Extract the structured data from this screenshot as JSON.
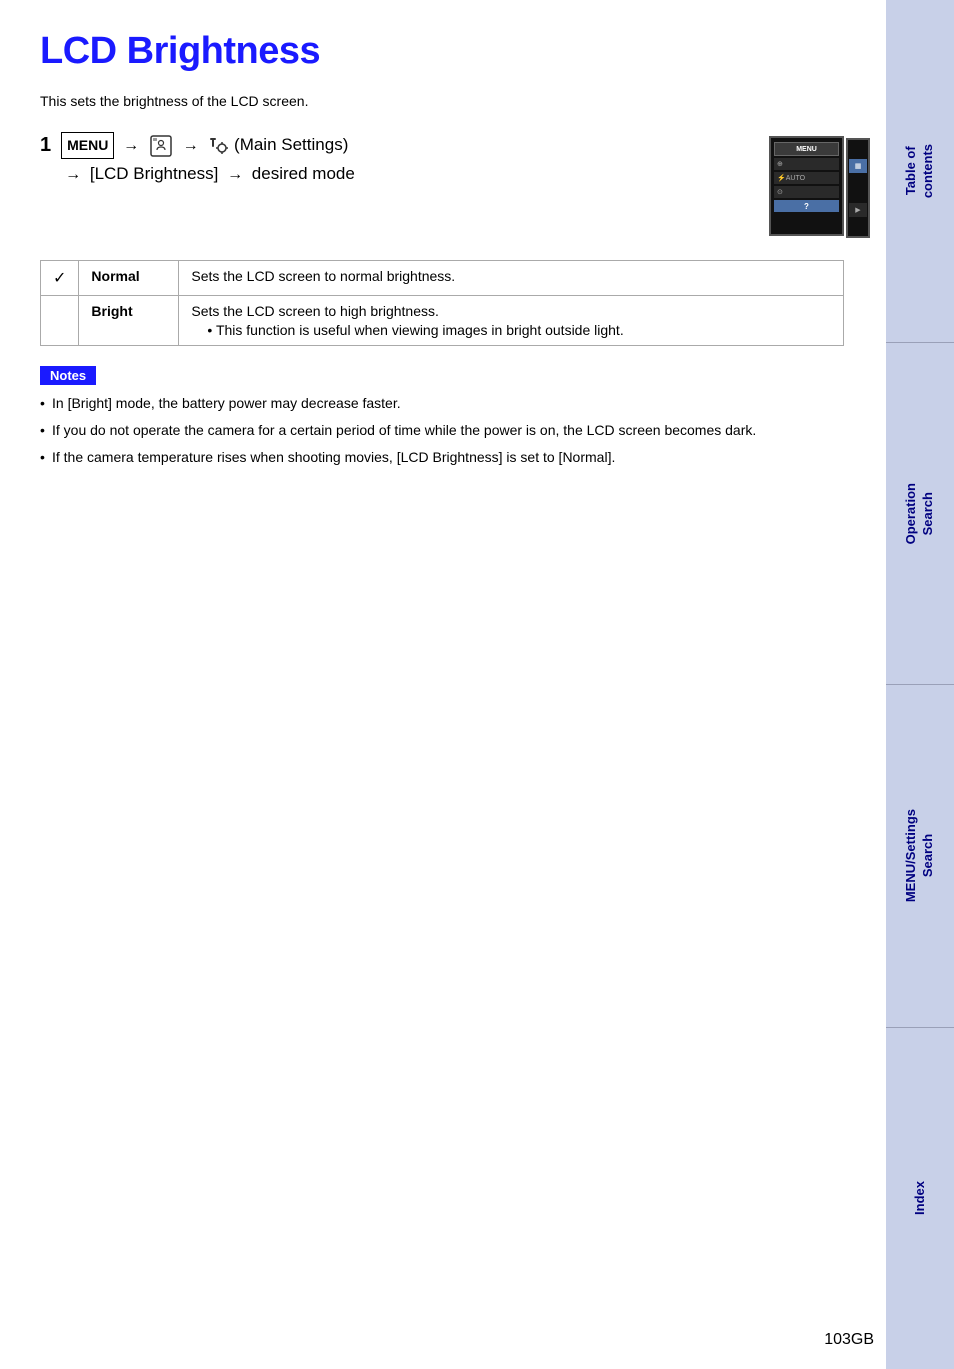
{
  "page": {
    "title": "LCD Brightness",
    "intro": "This sets the brightness of the LCD screen.",
    "step1": {
      "number": "1",
      "instruction_line1": " (Settings)  (Main Settings)",
      "instruction_line2": " [LCD Brightness]  desired mode"
    },
    "table": {
      "rows": [
        {
          "checkmark": "✓",
          "mode": "Normal",
          "description": "Sets the LCD screen to normal brightness.",
          "sub_bullets": []
        },
        {
          "checkmark": "",
          "mode": "Bright",
          "description": "Sets the LCD screen to high brightness.",
          "sub_bullets": [
            "This function is useful when viewing images in bright outside light."
          ]
        }
      ]
    },
    "notes": {
      "badge": "Notes",
      "items": [
        "In [Bright] mode, the battery power may decrease faster.",
        "If you do not operate the camera for a certain period of time while the power is on, the LCD screen becomes dark.",
        "If the camera temperature rises when shooting movies, [LCD Brightness] is set to [Normal]."
      ]
    },
    "page_number": "103GB"
  },
  "sidebar": {
    "sections": [
      {
        "id": "table-of-contents",
        "label_line1": "Table of",
        "label_line2": "contents"
      },
      {
        "id": "operation-search",
        "label_line1": "Operation",
        "label_line2": "Search"
      },
      {
        "id": "menu-settings-search",
        "label_line1": "MENU/Settings",
        "label_line2": "Search"
      },
      {
        "id": "index",
        "label_line1": "Index",
        "label_line2": ""
      }
    ]
  }
}
